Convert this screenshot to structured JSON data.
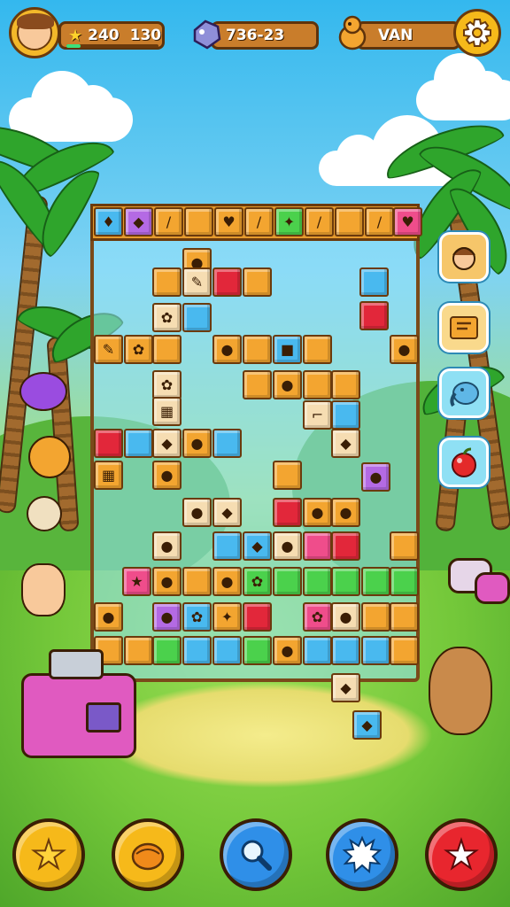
{
  "hud": {
    "stars_value": "240",
    "coins_value": "130",
    "gems_value": "736-23",
    "mascot_value": "VAN",
    "level_progress": 0.15
  },
  "icons": {
    "star": "star-icon",
    "gem": "gem-icon",
    "mascot": "mascot-icon",
    "settings": "gear-icon",
    "side_panel": [
      "character-icon",
      "block-icon",
      "elephant-icon",
      "apple-icon"
    ],
    "bottom_bar": [
      "star-icon",
      "acorn-icon",
      "search-icon",
      "splash-icon",
      "star-icon"
    ]
  },
  "colors": {
    "hud_bar": "#c97d2b",
    "hud_border": "#5e330b",
    "gold": "#f6b91a",
    "board_frame": "#7a4a1a"
  }
}
